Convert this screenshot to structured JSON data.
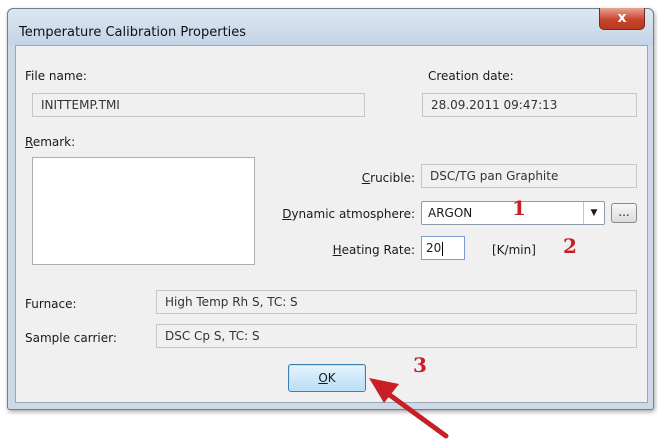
{
  "window": {
    "title": "Temperature Calibration Properties",
    "close_label": "x"
  },
  "file": {
    "name_label": "File name:",
    "name_value": "INITTEMP.TMI",
    "creation_label": "Creation date:",
    "creation_value": "28.09.2011 09:47:13"
  },
  "remark": {
    "label": "Remark:",
    "label_ul": "R",
    "label_rest": "emark:",
    "value": ""
  },
  "crucible": {
    "label_ul": "C",
    "label_rest": "rucible:",
    "value": "DSC/TG pan Graphite"
  },
  "atmosphere": {
    "label_ul": "D",
    "label_rest": "ynamic atmosphere:",
    "selected": "ARGON",
    "more_button": "..."
  },
  "heating": {
    "label_ul": "H",
    "label_rest": "eating Rate:",
    "value": "20",
    "unit": "[K/min]"
  },
  "furnace": {
    "label": "Furnace:",
    "value": "High Temp Rh S, TC: S"
  },
  "sample_carrier": {
    "label": "Sample carrier:",
    "value": "DSC Cp S, TC: S"
  },
  "ok_button": {
    "label_ul": "O",
    "label_rest": "K"
  },
  "annotations": {
    "marker1": "1",
    "marker2": "2",
    "marker3": "3",
    "accent_color": "#c62026"
  }
}
